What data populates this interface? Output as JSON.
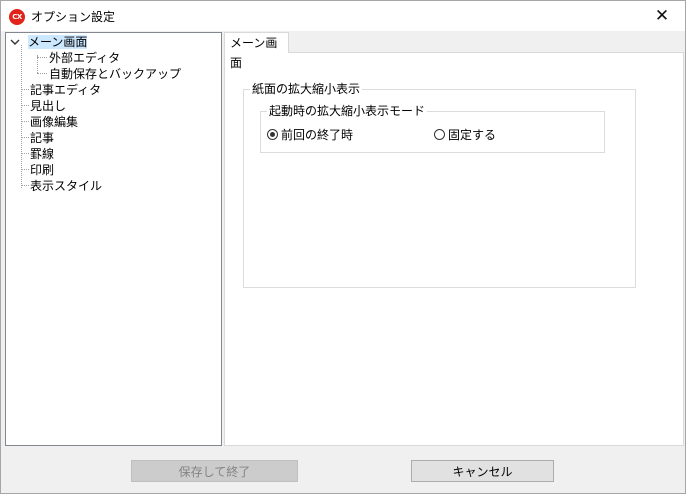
{
  "window": {
    "title": "オプション設定",
    "app_icon_text": "CX",
    "close_symbol": "✕"
  },
  "tree": {
    "items": [
      {
        "label": "メーン画面"
      },
      {
        "label": "外部エディタ"
      },
      {
        "label": "自動保存とバックアップ"
      },
      {
        "label": "記事エディタ"
      },
      {
        "label": "見出し"
      },
      {
        "label": "画像編集"
      },
      {
        "label": "記事"
      },
      {
        "label": "罫線"
      },
      {
        "label": "印刷"
      },
      {
        "label": "表示スタイル"
      }
    ]
  },
  "tabs": [
    {
      "label": "メーン画面"
    }
  ],
  "panel": {
    "group_title": "紙面の拡大縮小表示",
    "subgroup_title": "起動時の拡大縮小表示モード",
    "radio_options": [
      {
        "label": "前回の終了時",
        "checked": true
      },
      {
        "label": "固定する",
        "checked": false
      }
    ]
  },
  "buttons": {
    "save_label": "保存して終了",
    "cancel_label": "キャンセル"
  }
}
